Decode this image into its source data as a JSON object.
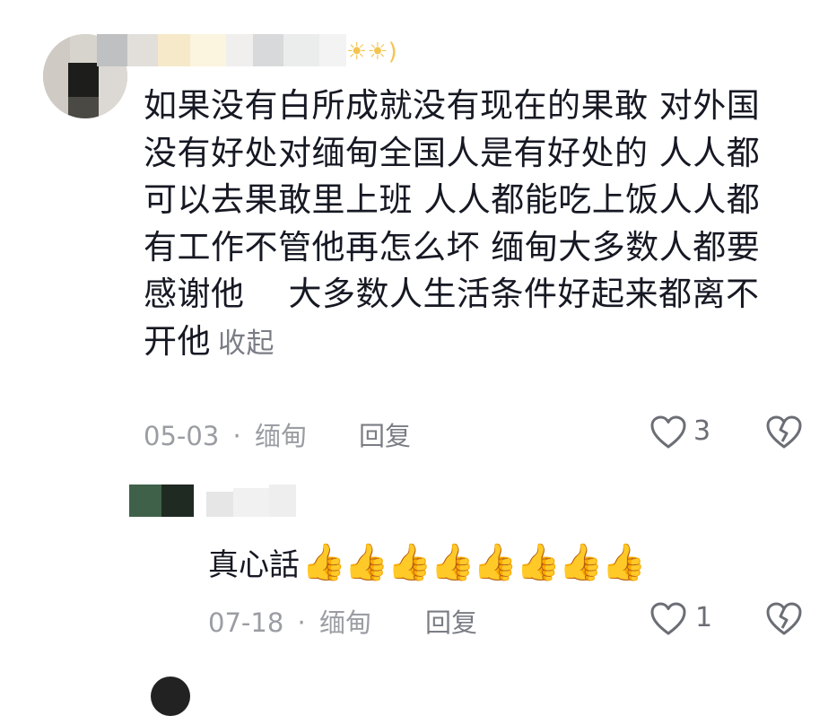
{
  "comment": {
    "lines": [
      "如果没有白所成就没有现在的果敢 对外国",
      "没有好处对缅甸全国人是有好处的 人人都",
      "可以去果敢里上班 人人都能吃上饭人人都",
      "有工作不管他再怎么坏 缅甸大多数人都要",
      "感谢他    大多数人生活条件好起来都离不",
      "开他"
    ],
    "collapse_label": "收起",
    "date": "05-03",
    "separator": "·",
    "location": "缅甸",
    "reply_label": "回复",
    "like_count": "3",
    "username_suffix": "☀☀)"
  },
  "reply": {
    "text": "真心話",
    "emoji": [
      "👍",
      "👍",
      "👍",
      "👍",
      "👍",
      "👍",
      "👍",
      "👍"
    ],
    "date": "07-18",
    "separator": "·",
    "location": "缅甸",
    "reply_label": "回复",
    "like_count": "1"
  },
  "icons": {
    "like": "heart-outline-icon",
    "dislike": "broken-heart-icon",
    "thumbs_up": "thumbs-up-emoji"
  },
  "colors": {
    "text": "#161823",
    "meta": "#9b9da3",
    "icon": "#6c6e75",
    "thumb": "#f5b731"
  }
}
